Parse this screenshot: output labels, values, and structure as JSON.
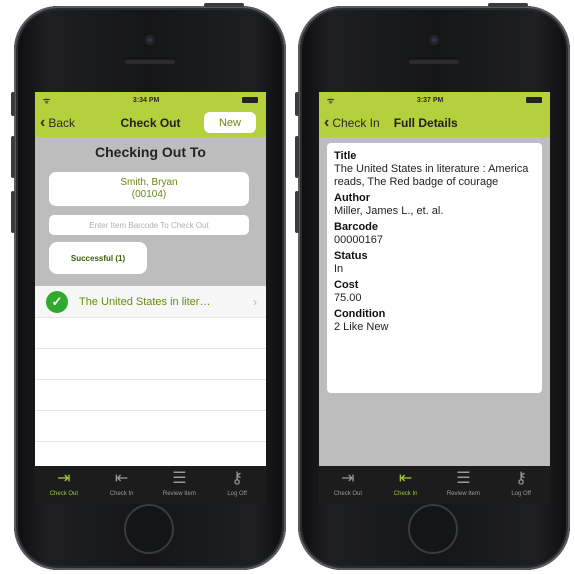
{
  "colors": {
    "accent_green": "#b6cf3c",
    "link_green": "#6a8a10",
    "check_green": "#2fa92f",
    "tabbar": "#1c1c1c"
  },
  "checkout_screen": {
    "status": {
      "time": "3:34 PM"
    },
    "nav": {
      "back_label": "Back",
      "title": "Check Out",
      "new_label": "New"
    },
    "heading": "Checking Out To",
    "patron": {
      "name": "Smith, Bryan",
      "id": "(00104)"
    },
    "barcode_input": {
      "placeholder": "Enter Item Barcode To Check Out",
      "value": ""
    },
    "successful_tab": "Successful (1)",
    "items": [
      {
        "icon": "checkmark-icon",
        "title": "The United States in liter…"
      }
    ],
    "tabbar": [
      {
        "label": "Check Out",
        "icon": "check-out-icon",
        "active": true
      },
      {
        "label": "Check In",
        "icon": "check-in-icon",
        "active": false
      },
      {
        "label": "Review Item",
        "icon": "list-icon",
        "active": false
      },
      {
        "label": "Log Off",
        "icon": "key-icon",
        "active": false
      }
    ]
  },
  "details_screen": {
    "status": {
      "time": "3:37 PM"
    },
    "nav": {
      "back_label": "Check In",
      "title": "Full Details"
    },
    "fields": [
      {
        "label": "Title",
        "value": "The United States in literature : America reads, The Red badge of courage"
      },
      {
        "label": "Author",
        "value": "Miller, James L., et. al."
      },
      {
        "label": "Barcode",
        "value": "00000167"
      },
      {
        "label": "Status",
        "value": "In"
      },
      {
        "label": "Cost",
        "value": "75.00"
      },
      {
        "label": "Condition",
        "value": "2 Like New"
      }
    ],
    "tabbar": [
      {
        "label": "Check Out",
        "icon": "check-out-icon",
        "active": false
      },
      {
        "label": "Check In",
        "icon": "check-in-icon",
        "active": true
      },
      {
        "label": "Review Item",
        "icon": "list-icon",
        "active": false
      },
      {
        "label": "Log Off",
        "icon": "key-icon",
        "active": false
      }
    ]
  }
}
